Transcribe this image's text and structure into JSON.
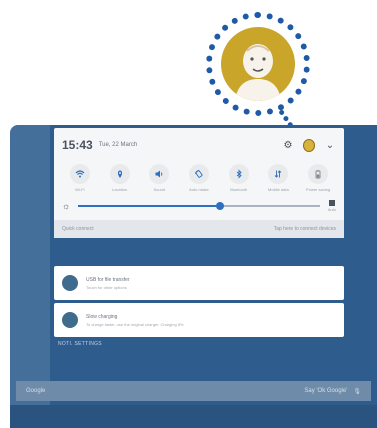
{
  "status_bar": {
    "time": "15:43",
    "date": "Tue, 22 March"
  },
  "quick_settings": [
    {
      "label": "Wi-Fi"
    },
    {
      "label": "Location"
    },
    {
      "label": "Sound"
    },
    {
      "label": "Auto rotate"
    },
    {
      "label": "Bluetooth"
    },
    {
      "label": "Mobile data"
    },
    {
      "label": "Power saving"
    }
  ],
  "brightness": {
    "level_percent": 57,
    "auto_label": "Auto"
  },
  "quick_connect": {
    "label": "Quick connect",
    "hint": "Tap here to connect devices"
  },
  "notifications": [
    {
      "title": "USB for file transfer",
      "subtitle": "Touch for other options"
    },
    {
      "title": "Slow charging",
      "subtitle": "To charge faster, use the original charger. Charging 8%"
    }
  ],
  "notification_settings_label": "NOTI. SETTINGS",
  "search_bar": {
    "placeholder": "Google",
    "hint": "Say 'Ok Google'"
  },
  "colors": {
    "accent": "#2f6fbf",
    "callout_border": "#1f5aa6",
    "avatar": "#c9a62a",
    "wallpaper": "#2e5c8c"
  }
}
